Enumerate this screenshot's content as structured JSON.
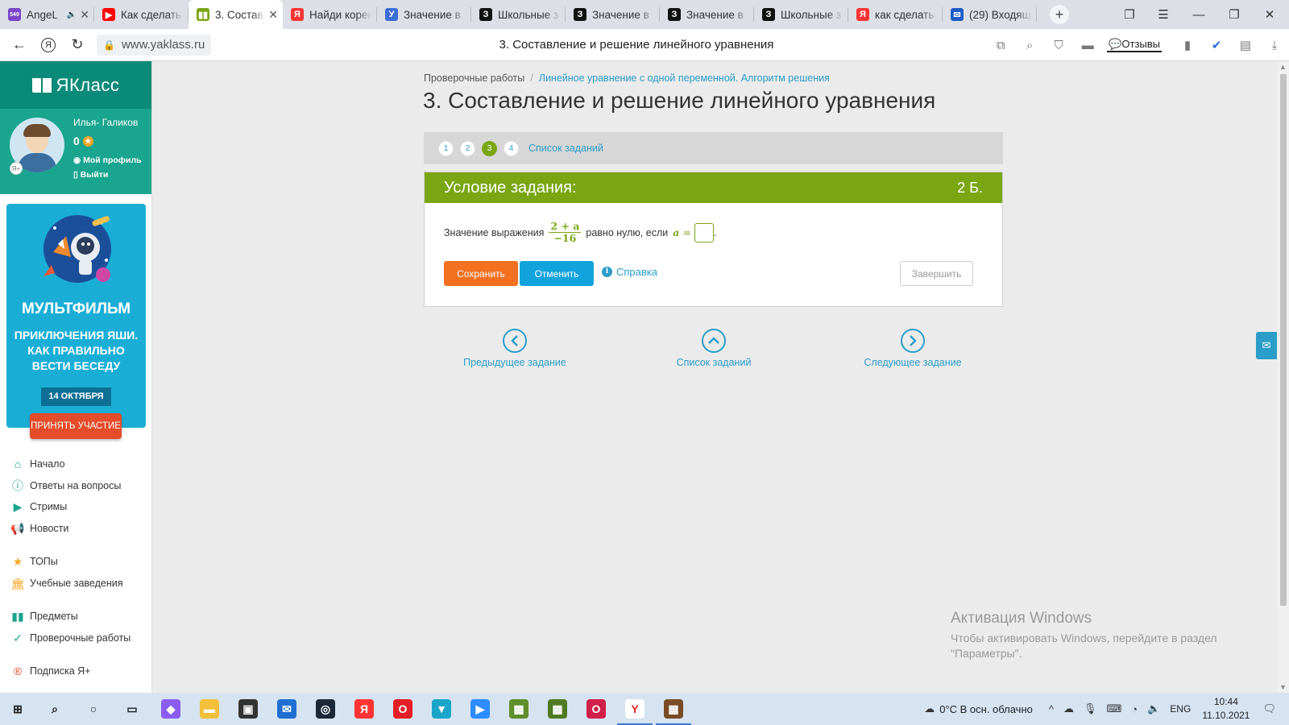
{
  "tabs": [
    {
      "title": "AngeL",
      "fav_color": "#7a45c8",
      "fav_text": "549",
      "speaker": true
    },
    {
      "title": "Как сделать",
      "fav_color": "#ff0000",
      "fav_text": "▶"
    },
    {
      "title": "3. Составл",
      "fav_color": "#7aa613",
      "fav_text": "▮▮",
      "active": true
    },
    {
      "title": "Найди корень",
      "fav_color": "#f33",
      "fav_text": "Я"
    },
    {
      "title": "Значение в",
      "fav_color": "#3a6cd8",
      "fav_text": "У"
    },
    {
      "title": "Школьные з",
      "fav_color": "#111",
      "fav_text": "З"
    },
    {
      "title": "Значение в",
      "fav_color": "#111",
      "fav_text": "З"
    },
    {
      "title": "Значение в",
      "fav_color": "#111",
      "fav_text": "З"
    },
    {
      "title": "Школьные з",
      "fav_color": "#111",
      "fav_text": "З"
    },
    {
      "title": "как сделать",
      "fav_color": "#f33",
      "fav_text": "Я"
    },
    {
      "title": "(29) Входящ",
      "fav_color": "#1e5bc6",
      "fav_text": "✉"
    }
  ],
  "address": {
    "url": "www.yaklass.ru",
    "page_title": "3. Составление и решение линейного уравнения",
    "reviews_label": "Отзывы"
  },
  "sidebar": {
    "logo": "ЯКласс",
    "user": {
      "name": "Илья- Галиков",
      "points": "0",
      "profile_link": "Мой профиль",
      "logout_link": "Выйти",
      "badge": "Я+"
    },
    "banner": {
      "title": "МУЛЬТФИЛЬМ",
      "subtitle": "ПРИКЛЮЧЕНИЯ ЯШИ. КАК ПРАВИЛЬНО ВЕСТИ БЕСЕДУ",
      "date": "14 ОКТЯБРЯ",
      "button": "ПРИНЯТЬ УЧАСТИЕ"
    },
    "menu": [
      "Начало",
      "Ответы на вопросы",
      "Стримы",
      "Новости",
      "ТОПы",
      "Учебные заведения",
      "Предметы",
      "Проверочные работы",
      "Подписка Я+"
    ]
  },
  "main": {
    "breadcrumb": {
      "root": "Проверочные работы",
      "separator": "/",
      "current": "Линейное уравнение с одной переменной. Алгоритм решения"
    },
    "heading": "3. Составление и решение линейного уравнения",
    "steps": [
      "1",
      "2",
      "3",
      "4"
    ],
    "current_step": 3,
    "task_list_link": "Список заданий",
    "task": {
      "header": "Условие задания:",
      "points": "2 Б.",
      "question_prefix": "Значение выражения",
      "fraction_num": "2 + a",
      "fraction_den": "−16",
      "question_middle": "равно нулю, если",
      "variable": "a",
      "equals": "=",
      "question_suffix": ".",
      "answer_value": ""
    },
    "buttons": {
      "save": "Сохранить",
      "cancel": "Отменить",
      "help": "Справка",
      "finish": "Завершить"
    },
    "nav": {
      "prev": "Предыдущее задание",
      "list": "Список заданий",
      "next": "Следующее задание"
    },
    "activation": {
      "title": "Активация Windows",
      "text": "Чтобы активировать Windows, перейдите в раздел \"Параметры\"."
    }
  },
  "colors": {
    "brand_green": "#7aa613",
    "sidebar_teal": "#19a58f",
    "save_orange": "#f37021",
    "cancel_blue": "#12a3dc",
    "link_blue": "#2a9dc8"
  },
  "taskbar": {
    "apps": [
      "windows-start",
      "search",
      "cortana",
      "task-view",
      "app-purple",
      "file-explorer",
      "store",
      "mail",
      "steam",
      "yandex-y",
      "opera",
      "vpn",
      "zoom",
      "minecraft-1",
      "minecraft-2",
      "opera-gx",
      "yandex-browser",
      "app-box"
    ],
    "weather": "0°C  В осн. облачно",
    "lang": "ENG",
    "time": "10:44",
    "date": "11.10.2021"
  }
}
